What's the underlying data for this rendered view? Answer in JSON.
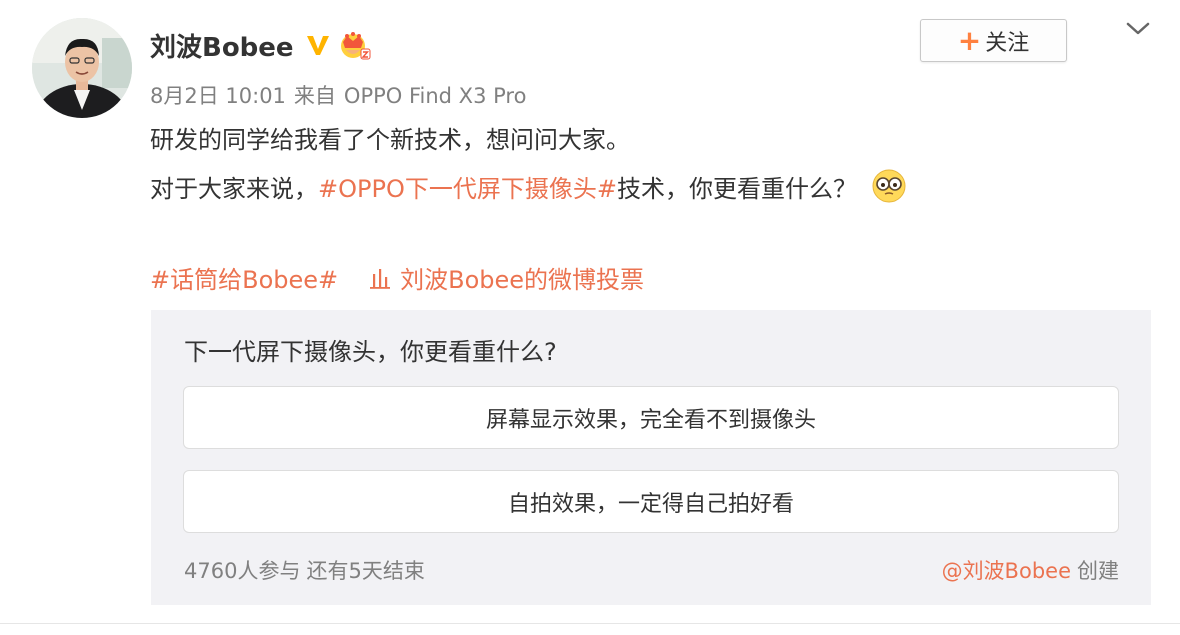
{
  "post": {
    "username": "刘波Bobee",
    "follow_label": "关注",
    "follow_plus": "+",
    "date": "8月2日 10:01",
    "source_prefix": "来自",
    "source_device": "OPPO Find X3 Pro",
    "line1": "研发的同学给我看了个新技术，想问问大家。",
    "line2_prefix": "对于大家来说，",
    "line2_topic": "#OPPO下一代屏下摄像头#",
    "line2_suffix": "技术，你更看重什么？",
    "tag": "#话筒给Bobee#",
    "vote_link": "刘波Bobee的微博投票"
  },
  "poll": {
    "question": "下一代屏下摄像头，你更看重什么?",
    "options": [
      {
        "label": "屏幕显示效果，完全看不到摄像头"
      },
      {
        "label": "自拍效果，一定得自己拍好看"
      }
    ],
    "participants": "4760人参与",
    "remaining": "还有5天结束",
    "creator": "@刘波Bobee",
    "creator_suffix": "创建"
  },
  "icons": {
    "verified": "verified-v-icon",
    "crown": "vip-crown-icon",
    "chevron": "chevron-down-icon",
    "vote": "bar-chart-icon",
    "emoji": "glasses-emoji-icon"
  },
  "colors": {
    "accent": "#eb7350",
    "follow_plus": "#ff8140",
    "verified": "#ffb400",
    "poll_bg": "#f2f2f5",
    "meta_text": "#808080"
  }
}
